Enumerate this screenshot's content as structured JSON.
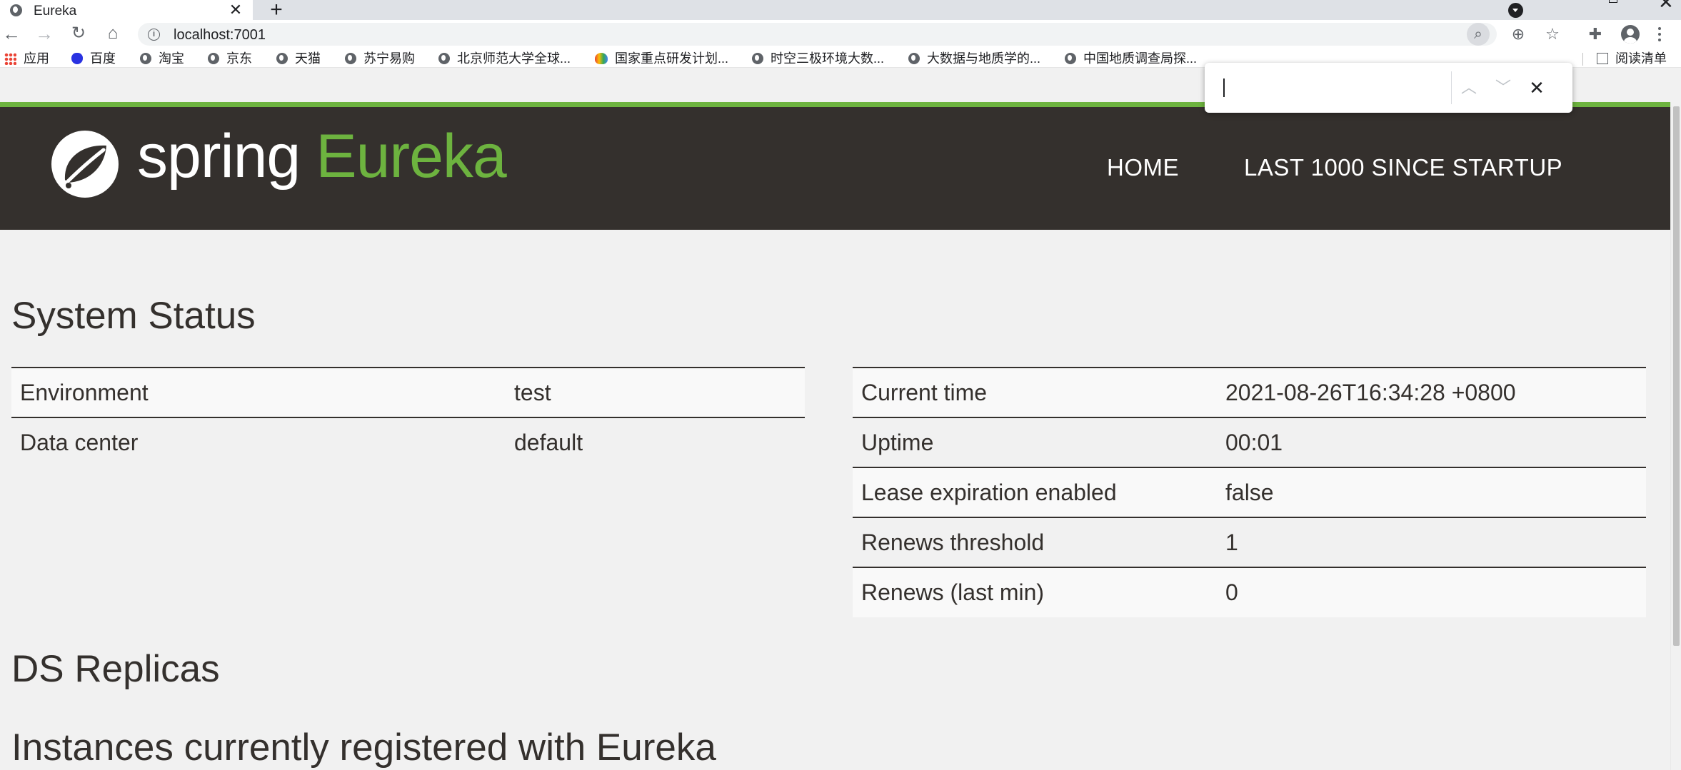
{
  "browser": {
    "tab_title": "Eureka",
    "url": "localhost:7001",
    "bookmarks": [
      "应用",
      "百度",
      "淘宝",
      "京东",
      "天猫",
      "苏宁易购",
      "北京师范大学全球...",
      "国家重点研发计划...",
      "时空三极环境大数...",
      "大数据与地质学的...",
      "中国地质调查局探..."
    ],
    "reading_list": "阅读清单"
  },
  "header": {
    "brand_spring": "spring",
    "brand_eureka": "Eureka",
    "nav": [
      "HOME",
      "LAST 1000 SINCE STARTUP"
    ]
  },
  "system_status": {
    "title": "System Status",
    "left_rows": [
      {
        "label": "Environment",
        "value": "test"
      },
      {
        "label": "Data center",
        "value": "default"
      }
    ],
    "right_rows": [
      {
        "label": "Current time",
        "value": "2021-08-26T16:34:28 +0800"
      },
      {
        "label": "Uptime",
        "value": "00:01"
      },
      {
        "label": "Lease expiration enabled",
        "value": "false"
      },
      {
        "label": "Renews threshold",
        "value": "1"
      },
      {
        "label": "Renews (last min)",
        "value": "0"
      }
    ]
  },
  "ds_replicas": {
    "title": "DS Replicas"
  },
  "instances": {
    "title": "Instances currently registered with Eureka"
  },
  "colors": {
    "brand_green": "#6db33f",
    "navbar_bg": "#34302d",
    "page_bg": "#f1f1f1"
  }
}
